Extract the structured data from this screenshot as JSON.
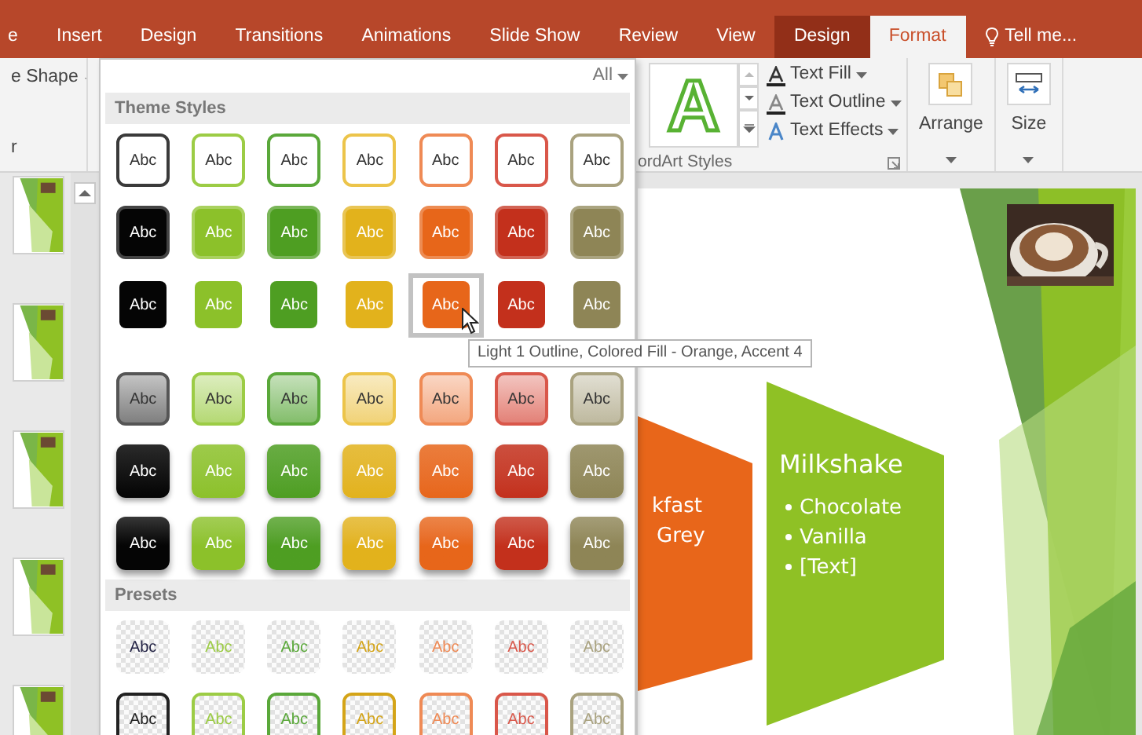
{
  "tabs": [
    {
      "label": "e",
      "kind": "normal",
      "selected": false
    },
    {
      "label": "Insert",
      "kind": "normal",
      "selected": false
    },
    {
      "label": "Design",
      "kind": "normal",
      "selected": false
    },
    {
      "label": "Transitions",
      "kind": "normal",
      "selected": false
    },
    {
      "label": "Animations",
      "kind": "normal",
      "selected": false
    },
    {
      "label": "Slide Show",
      "kind": "normal",
      "selected": false
    },
    {
      "label": "Review",
      "kind": "normal",
      "selected": false
    },
    {
      "label": "View",
      "kind": "normal",
      "selected": false
    },
    {
      "label": "Design",
      "kind": "contextual",
      "selected": false
    },
    {
      "label": "Format",
      "kind": "contextual",
      "selected": true
    }
  ],
  "tell_me": "Tell me...",
  "ribbon": {
    "left_items": [
      "e Shape",
      "r"
    ],
    "wordart": {
      "preview": "A",
      "commands": [
        {
          "kind": "fill",
          "label": "Text Fill"
        },
        {
          "kind": "outline",
          "label": "Text Outline"
        },
        {
          "kind": "effects",
          "label": "Text Effects"
        }
      ],
      "group_label": "ordArt Styles"
    },
    "buttons": [
      {
        "kind": "arrange",
        "label": "Arrange"
      },
      {
        "kind": "size",
        "label": "Size"
      }
    ]
  },
  "thumbnails": [
    {
      "selected": false
    },
    {
      "selected": false
    },
    {
      "selected": false
    },
    {
      "selected": false
    },
    {
      "selected": false
    }
  ],
  "gallery": {
    "filter": "All",
    "sections": [
      {
        "title": "Theme Styles",
        "rows": [
          {
            "kind": "outline",
            "swatches": [
              {
                "label": "Abc",
                "color": "#3a3a3a",
                "selected": false
              },
              {
                "label": "Abc",
                "color": "#9ccc45",
                "selected": false
              },
              {
                "label": "Abc",
                "color": "#5aa83a",
                "selected": false
              },
              {
                "label": "Abc",
                "color": "#ecc44a",
                "selected": false
              },
              {
                "label": "Abc",
                "color": "#ef8a55",
                "selected": false
              },
              {
                "label": "Abc",
                "color": "#d9574a",
                "selected": false
              },
              {
                "label": "Abc",
                "color": "#a9a27f",
                "selected": false
              }
            ]
          },
          {
            "kind": "bordered_fill",
            "swatches": [
              {
                "label": "Abc",
                "color": "#050505",
                "selected": false
              },
              {
                "label": "Abc",
                "color": "#8cc12a",
                "selected": false
              },
              {
                "label": "Abc",
                "color": "#4e9e22",
                "selected": false
              },
              {
                "label": "Abc",
                "color": "#e2b21c",
                "selected": false
              },
              {
                "label": "Abc",
                "color": "#e7661a",
                "selected": false
              },
              {
                "label": "Abc",
                "color": "#c3301c",
                "selected": false
              },
              {
                "label": "Abc",
                "color": "#8e8556",
                "selected": false
              }
            ]
          },
          {
            "kind": "fill",
            "swatches": [
              {
                "label": "Abc",
                "color": "#050505",
                "selected": false
              },
              {
                "label": "Abc",
                "color": "#8cc12a",
                "selected": false
              },
              {
                "label": "Abc",
                "color": "#4e9e22",
                "selected": false
              },
              {
                "label": "Abc",
                "color": "#e2b21c",
                "selected": false
              },
              {
                "label": "Abc",
                "color": "#e7661a",
                "selected": true
              },
              {
                "label": "Abc",
                "color": "#c3301c",
                "selected": false
              },
              {
                "label": "Abc",
                "color": "#8e8556",
                "selected": false
              }
            ]
          },
          {
            "kind": "light_gradient",
            "swatches": [
              {
                "label": "Abc",
                "color": "#555555",
                "selected": false
              },
              {
                "label": "Abc",
                "color": "#9ccc45",
                "selected": false
              },
              {
                "label": "Abc",
                "color": "#5aa83a",
                "selected": false
              },
              {
                "label": "Abc",
                "color": "#ecc44a",
                "selected": false
              },
              {
                "label": "Abc",
                "color": "#ef8a55",
                "selected": false
              },
              {
                "label": "Abc",
                "color": "#d9574a",
                "selected": false
              },
              {
                "label": "Abc",
                "color": "#a9a27f",
                "selected": false
              }
            ]
          },
          {
            "kind": "gradient",
            "swatches": [
              {
                "label": "Abc",
                "color": "#050505",
                "selected": false
              },
              {
                "label": "Abc",
                "color": "#8cc12a",
                "selected": false
              },
              {
                "label": "Abc",
                "color": "#4e9e22",
                "selected": false
              },
              {
                "label": "Abc",
                "color": "#e2b21c",
                "selected": false
              },
              {
                "label": "Abc",
                "color": "#e7661a",
                "selected": false
              },
              {
                "label": "Abc",
                "color": "#c3301c",
                "selected": false
              },
              {
                "label": "Abc",
                "color": "#8e8556",
                "selected": false
              }
            ]
          },
          {
            "kind": "intense_gradient",
            "swatches": [
              {
                "label": "Abc",
                "color": "#050505",
                "selected": false
              },
              {
                "label": "Abc",
                "color": "#8cc12a",
                "selected": false
              },
              {
                "label": "Abc",
                "color": "#4e9e22",
                "selected": false
              },
              {
                "label": "Abc",
                "color": "#e2b21c",
                "selected": false
              },
              {
                "label": "Abc",
                "color": "#e7661a",
                "selected": false
              },
              {
                "label": "Abc",
                "color": "#c3301c",
                "selected": false
              },
              {
                "label": "Abc",
                "color": "#8e8556",
                "selected": false
              }
            ]
          }
        ]
      },
      {
        "title": "Presets",
        "rows": [
          {
            "kind": "transparent",
            "swatches": [
              {
                "label": "Abc",
                "color": "#222244",
                "selected": false
              },
              {
                "label": "Abc",
                "color": "#9ccc45",
                "selected": false
              },
              {
                "label": "Abc",
                "color": "#5aa83a",
                "selected": false
              },
              {
                "label": "Abc",
                "color": "#d4a418",
                "selected": false
              },
              {
                "label": "Abc",
                "color": "#ef8a55",
                "selected": false
              },
              {
                "label": "Abc",
                "color": "#d9574a",
                "selected": false
              },
              {
                "label": "Abc",
                "color": "#a9a27f",
                "selected": false
              }
            ]
          },
          {
            "kind": "transparent_outline",
            "swatches": [
              {
                "label": "Abc",
                "color": "#222222",
                "selected": false
              },
              {
                "label": "Abc",
                "color": "#9ccc45",
                "selected": false
              },
              {
                "label": "Abc",
                "color": "#5aa83a",
                "selected": false
              },
              {
                "label": "Abc",
                "color": "#d4a418",
                "selected": false
              },
              {
                "label": "Abc",
                "color": "#ef8a55",
                "selected": false
              },
              {
                "label": "Abc",
                "color": "#d9574a",
                "selected": false
              },
              {
                "label": "Abc",
                "color": "#a9a27f",
                "selected": false
              }
            ]
          }
        ]
      }
    ]
  },
  "tooltip": "Light 1 Outline, Colored Fill - Orange, Accent 4",
  "slide": {
    "shapes": [
      {
        "color": "#e8661a",
        "lines": [
          "kfast",
          "Grey"
        ]
      },
      {
        "color": "#8fc125",
        "title": "Milkshake",
        "bullets": [
          "Chocolate",
          "Vanilla",
          "[Text]"
        ]
      }
    ]
  }
}
